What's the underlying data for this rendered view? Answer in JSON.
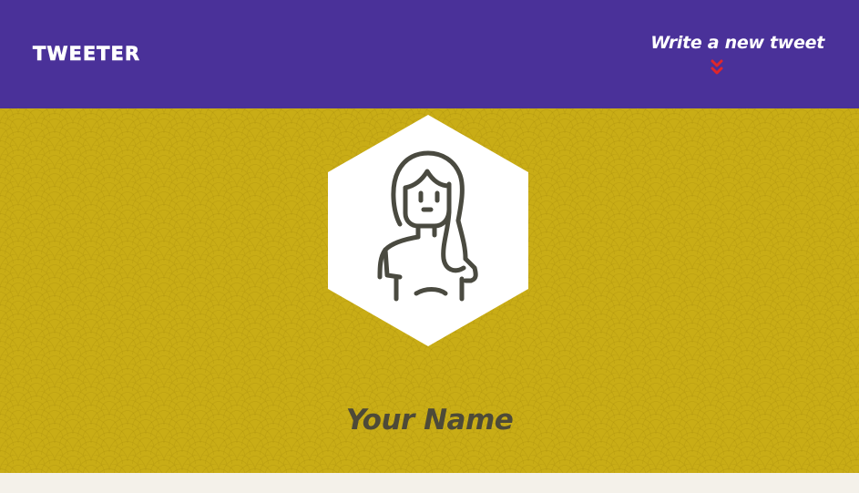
{
  "navbar": {
    "brand": "TWEETER",
    "compose_label": "Write a new tweet",
    "compose_icon": "double-chevron-down-icon"
  },
  "profile": {
    "avatar_icon": "user-avatar-icon",
    "name": "Your Name"
  },
  "colors": {
    "navbar_bg": "#4a3199",
    "profile_bg": "#c9ad16",
    "chevron": "#e0262b",
    "name_text": "#4d4a38",
    "avatar_stroke": "#4a4a40",
    "page_bg": "#f4f1ea"
  }
}
